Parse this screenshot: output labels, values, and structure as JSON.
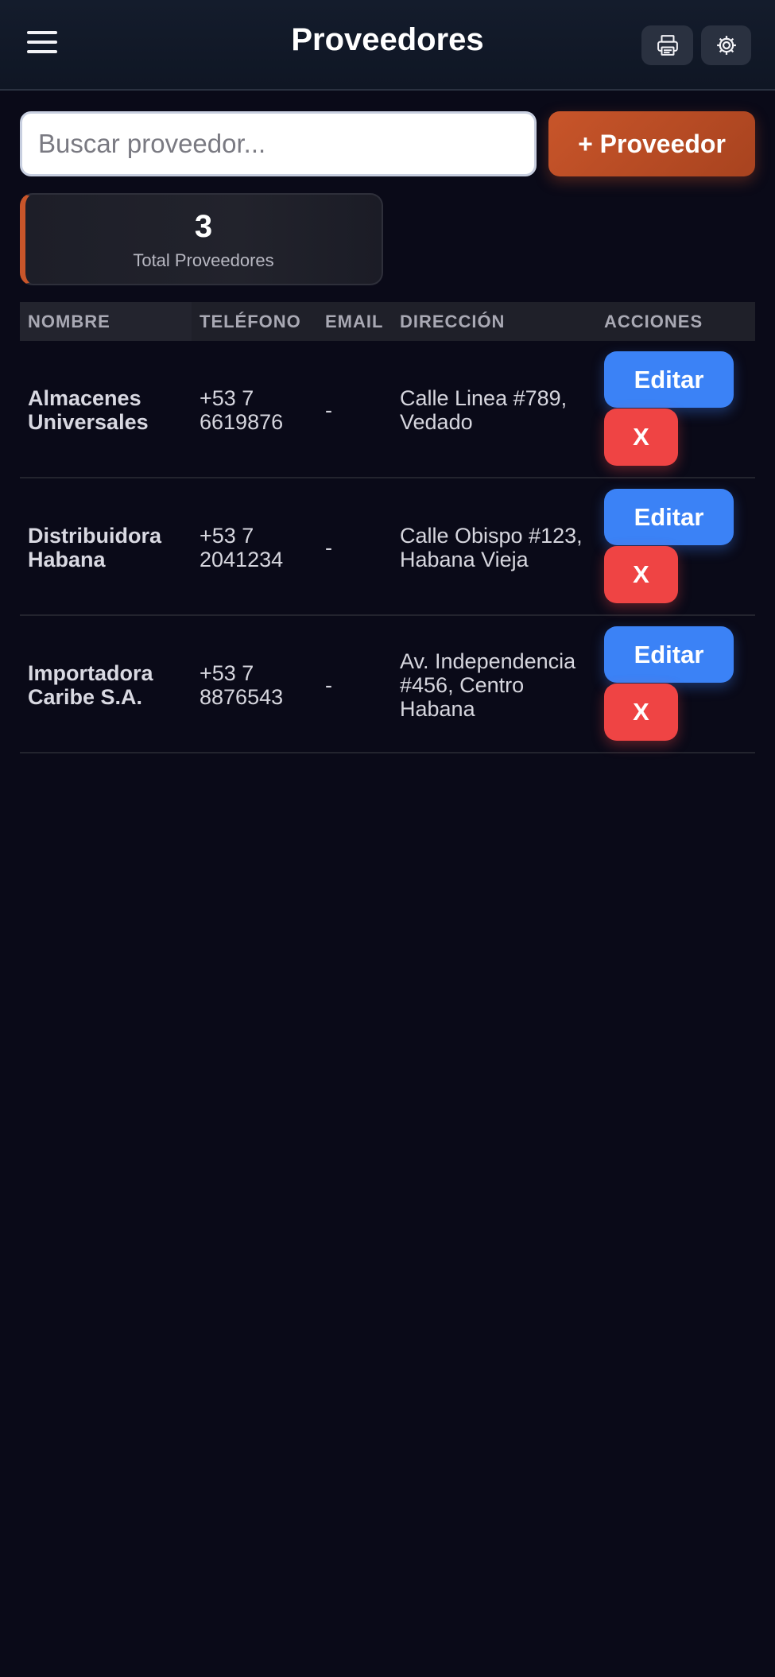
{
  "header": {
    "title": "Proveedores",
    "menu_icon": "hamburger-menu-icon",
    "print_icon": "printer-icon",
    "settings_icon": "gear-icon"
  },
  "toolbar": {
    "search_placeholder": "Buscar proveedor...",
    "search_value": "",
    "add_label": "+ Proveedor"
  },
  "stats": {
    "total_value": "3",
    "total_label": "Total Proveedores"
  },
  "table": {
    "columns": [
      "NOMBRE",
      "TELÉFONO",
      "EMAIL",
      "DIRECCIÓN",
      "ACCIONES"
    ],
    "rows": [
      {
        "name_line1": "Almacenes",
        "name_line2": "Universales",
        "phone_line1": "+53 7",
        "phone_line2": "6619876",
        "email": "-",
        "address_line1": "Calle Linea #789,",
        "address_line2": "Vedado",
        "address_line3": "",
        "edit_label": "Editar",
        "delete_label": "X"
      },
      {
        "name_line1": "Distribuidora",
        "name_line2": "Habana",
        "phone_line1": "+53 7",
        "phone_line2": "2041234",
        "email": "-",
        "address_line1": "Calle Obispo #123,",
        "address_line2": "Habana Vieja",
        "address_line3": "",
        "edit_label": "Editar",
        "delete_label": "X"
      },
      {
        "name_line1": "Importadora",
        "name_line2": "Caribe S.A.",
        "phone_line1": "+53 7",
        "phone_line2": "8876543",
        "email": "-",
        "address_line1": "Av. Independencia",
        "address_line2": "#456, Centro",
        "address_line3": "Habana",
        "edit_label": "Editar",
        "delete_label": "X"
      }
    ]
  },
  "colors": {
    "background": "#0a0a18",
    "accent": "#c8552a",
    "edit": "#3b82f6",
    "delete": "#ef4444"
  }
}
